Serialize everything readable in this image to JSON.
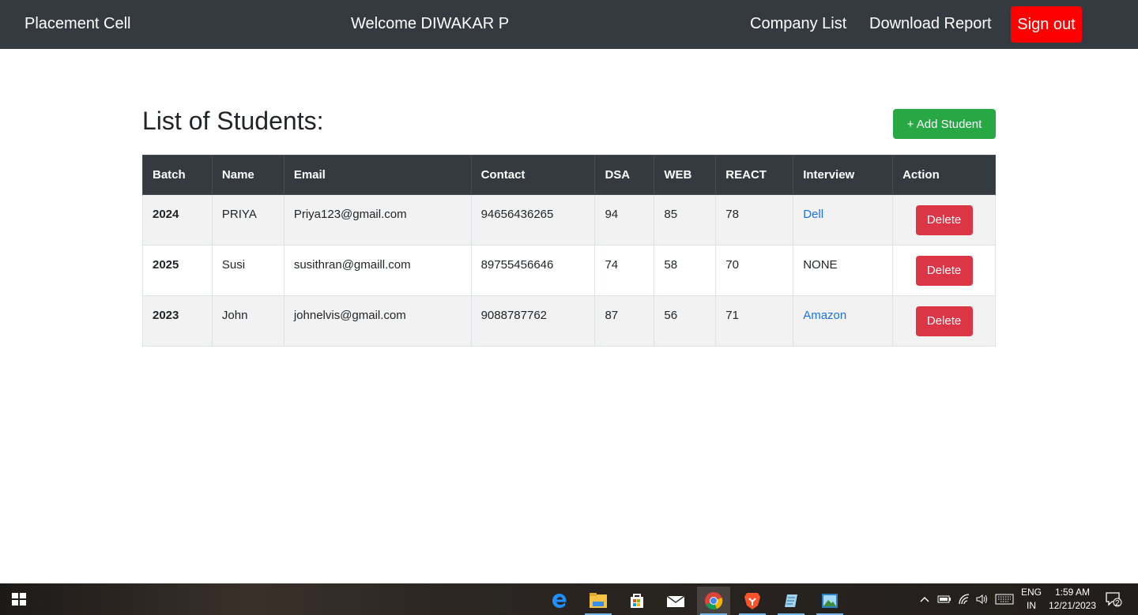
{
  "navbar": {
    "brand": "Placement Cell",
    "welcome": "Welcome DIWAKAR P",
    "company_list": "Company List",
    "download_report": "Download Report",
    "sign_out": "Sign out"
  },
  "main": {
    "title": "List of Students:",
    "add_student": "+ Add Student"
  },
  "table": {
    "headers": [
      "Batch",
      "Name",
      "Email",
      "Contact",
      "DSA",
      "WEB",
      "REACT",
      "Interview",
      "Action"
    ],
    "rows": [
      {
        "batch": "2024",
        "name": "PRIYA",
        "email": "Priya123@gmail.com",
        "contact": "94656436265",
        "dsa": "94",
        "web": "85",
        "react": "78",
        "interview": "Dell",
        "action": "Delete"
      },
      {
        "batch": "2025",
        "name": "Susi",
        "email": "susithran@gmaill.com",
        "contact": "89755456646",
        "dsa": "74",
        "web": "58",
        "react": "70",
        "interview": "NONE",
        "action": "Delete"
      },
      {
        "batch": "2023",
        "name": "John",
        "email": "johnelvis@gmail.com",
        "contact": "9088787762",
        "dsa": "87",
        "web": "56",
        "react": "71",
        "interview": "Amazon",
        "action": "Delete"
      }
    ]
  },
  "taskbar": {
    "icons": [
      "windows-start-icon",
      "edge-icon",
      "file-explorer-icon",
      "store-icon",
      "mail-icon",
      "chrome-icon",
      "brave-icon",
      "notepad-icon",
      "photos-icon"
    ],
    "tray": {
      "lang_line1": "ENG",
      "lang_line2": "IN",
      "time": "1:59 AM",
      "date": "12/21/2023",
      "notification_count": "2"
    }
  },
  "colors": {
    "navbar": "#343a40",
    "sign_out": "#ff0000",
    "add_student": "#28a745",
    "delete": "#dc3545",
    "link": "#1a73e8"
  }
}
